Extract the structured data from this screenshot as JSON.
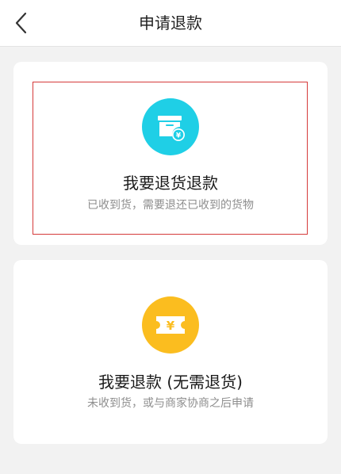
{
  "header": {
    "title": "申请退款",
    "back_icon": "chevron-left-icon"
  },
  "options": [
    {
      "title": "我要退货退款",
      "description": "已收到货，需要退还已收到的货物",
      "icon": "box-yuan-icon",
      "icon_color": "#1fcfe6",
      "selected": true
    },
    {
      "title": "我要退款 (无需退货)",
      "description": "未收到货，或与商家协商之后申请",
      "icon": "ticket-yuan-icon",
      "icon_color": "#fbbd1f",
      "selected": false
    }
  ],
  "colors": {
    "background": "#f2f2f2",
    "card": "#ffffff",
    "selection_border": "#d53a3a"
  }
}
